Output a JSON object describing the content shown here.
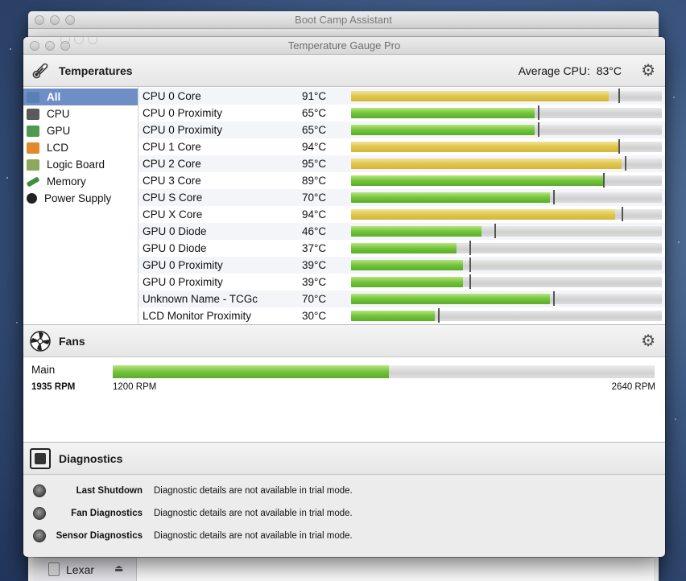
{
  "back_window": {
    "title": "Boot Camp Assistant",
    "drive_label": "Lexar"
  },
  "window": {
    "title": "Temperature Gauge Pro"
  },
  "temperatures": {
    "section_title": "Temperatures",
    "average_label": "Average CPU:",
    "average_value": "83°C",
    "sidebar": [
      {
        "label": "All",
        "selected": true,
        "icon": "display-icon",
        "color": "#5a7fb5"
      },
      {
        "label": "CPU",
        "selected": false,
        "icon": "cpu-icon",
        "color": "#5a5a5a"
      },
      {
        "label": "GPU",
        "selected": false,
        "icon": "gpu-icon",
        "color": "#4f9a4f"
      },
      {
        "label": "LCD",
        "selected": false,
        "icon": "lcd-icon",
        "color": "#e08a2c"
      },
      {
        "label": "Logic Board",
        "selected": false,
        "icon": "logic-board-icon",
        "color": "#8da85a"
      },
      {
        "label": "Memory",
        "selected": false,
        "icon": "memory-icon",
        "color": "#3e8e3e"
      },
      {
        "label": "Power Supply",
        "selected": false,
        "icon": "power-icon",
        "color": "#222222"
      }
    ],
    "rows": [
      {
        "name": "CPU 0 Core",
        "value": "91°C",
        "fill": 0.83,
        "mark": 0.86,
        "color": "yellow"
      },
      {
        "name": "CPU 0 Proximity",
        "value": "65°C",
        "fill": 0.59,
        "mark": 0.6,
        "color": "green"
      },
      {
        "name": "CPU 0 Proximity",
        "value": "65°C",
        "fill": 0.59,
        "mark": 0.6,
        "color": "green"
      },
      {
        "name": "CPU 1 Core",
        "value": "94°C",
        "fill": 0.86,
        "mark": 0.86,
        "color": "yellow"
      },
      {
        "name": "CPU 2 Core",
        "value": "95°C",
        "fill": 0.87,
        "mark": 0.88,
        "color": "yellow"
      },
      {
        "name": "CPU 3 Core",
        "value": "89°C",
        "fill": 0.81,
        "mark": 0.81,
        "color": "green"
      },
      {
        "name": "CPU S Core",
        "value": "70°C",
        "fill": 0.64,
        "mark": 0.65,
        "color": "green"
      },
      {
        "name": "CPU X Core",
        "value": "94°C",
        "fill": 0.85,
        "mark": 0.87,
        "color": "yellow"
      },
      {
        "name": "GPU 0 Diode",
        "value": "46°C",
        "fill": 0.42,
        "mark": 0.46,
        "color": "green"
      },
      {
        "name": "GPU 0 Diode",
        "value": "37°C",
        "fill": 0.34,
        "mark": 0.38,
        "color": "green"
      },
      {
        "name": "GPU 0 Proximity",
        "value": "39°C",
        "fill": 0.36,
        "mark": 0.38,
        "color": "green"
      },
      {
        "name": "GPU 0 Proximity",
        "value": "39°C",
        "fill": 0.36,
        "mark": 0.38,
        "color": "green"
      },
      {
        "name": "Unknown Name - TCGc",
        "value": "70°C",
        "fill": 0.64,
        "mark": 0.65,
        "color": "green"
      },
      {
        "name": "LCD Monitor Proximity",
        "value": "30°C",
        "fill": 0.27,
        "mark": 0.28,
        "color": "green"
      }
    ]
  },
  "fans": {
    "section_title": "Fans",
    "name": "Main",
    "current_rpm": "1935 RPM",
    "min_rpm": "1200 RPM",
    "max_rpm": "2640 RPM",
    "fill": 0.51
  },
  "diagnostics": {
    "section_title": "Diagnostics",
    "items": [
      {
        "label": "Last Shutdown",
        "text": "Diagnostic details are not available in trial mode."
      },
      {
        "label": "Fan Diagnostics",
        "text": "Diagnostic details are not available in trial mode."
      },
      {
        "label": "Sensor Diagnostics",
        "text": "Diagnostic details are not available in trial mode."
      }
    ]
  }
}
